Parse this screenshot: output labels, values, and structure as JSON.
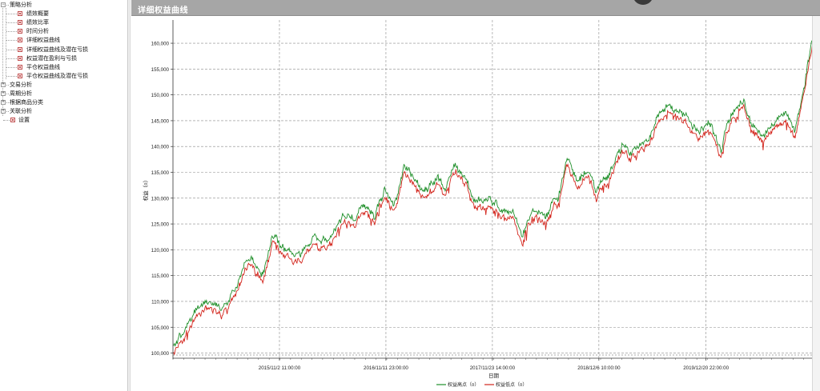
{
  "tree": {
    "items": [
      {
        "label": "策略分析",
        "level": 0,
        "kind": "folder",
        "expanded": true
      },
      {
        "label": "绩效概要",
        "level": 1,
        "kind": "leaf"
      },
      {
        "label": "绩效比率",
        "level": 1,
        "kind": "leaf"
      },
      {
        "label": "时间分析",
        "level": 1,
        "kind": "leaf"
      },
      {
        "label": "详细权益曲线",
        "level": 1,
        "kind": "leaf",
        "selected": true
      },
      {
        "label": "详细权益曲线及潜在亏损",
        "level": 1,
        "kind": "leaf"
      },
      {
        "label": "权益潜在盈利与亏损",
        "level": 1,
        "kind": "leaf"
      },
      {
        "label": "平仓权益曲线",
        "level": 1,
        "kind": "leaf"
      },
      {
        "label": "平仓权益曲线及潜在亏损",
        "level": 1,
        "kind": "leaf"
      },
      {
        "label": "交易分析",
        "level": 0,
        "kind": "folder",
        "expanded": false
      },
      {
        "label": "周期分析",
        "level": 0,
        "kind": "folder",
        "expanded": false
      },
      {
        "label": "根据商品分类",
        "level": 0,
        "kind": "folder",
        "expanded": false
      },
      {
        "label": "关联分析",
        "level": 0,
        "kind": "folder",
        "expanded": false
      },
      {
        "label": "设置",
        "level": 0,
        "kind": "leaf"
      }
    ],
    "expander_plus": "+",
    "expander_minus": "−"
  },
  "panel": {
    "title": "详细权益曲线"
  },
  "colors": {
    "high_series": "#1f8f2a",
    "low_series": "#d3261d",
    "grid": "#8a8a8a",
    "header_bg": "#a6a6a6"
  },
  "chart_data": {
    "type": "line",
    "xlabel": "日期",
    "ylabel": "权益（¤）",
    "ylim": [
      99000,
      164500
    ],
    "yticks": [
      100000,
      105000,
      110000,
      115000,
      120000,
      125000,
      130000,
      135000,
      140000,
      145000,
      150000,
      155000,
      160000
    ],
    "ytick_labels": [
      "100,000",
      "105,000",
      "110,000",
      "115,000",
      "120,000",
      "125,000",
      "130,000",
      "135,000",
      "140,000",
      "145,000",
      "150,000",
      "155,000",
      "160,000"
    ],
    "xticks": [
      "2015/11/2 11:00:00",
      "2016/11/11 23:00:00",
      "2017/11/23 14:00:00",
      "2018/12/6 10:00:00",
      "2019/12/20 22:00:00"
    ],
    "grid": true,
    "legend_position": "bottom-center",
    "series": [
      {
        "name": "权益高点（¤）",
        "color": "#1f8f2a"
      },
      {
        "name": "权益低点（¤）",
        "color": "#d3261d"
      }
    ],
    "x": [
      0,
      0.03,
      0.05,
      0.075,
      0.09,
      0.1,
      0.115,
      0.125,
      0.14,
      0.155,
      0.175,
      0.2,
      0.22,
      0.24,
      0.265,
      0.285,
      0.3,
      0.315,
      0.33,
      0.345,
      0.36,
      0.385,
      0.41,
      0.425,
      0.44,
      0.455,
      0.47,
      0.5,
      0.52,
      0.53,
      0.545,
      0.56,
      0.58,
      0.6,
      0.615,
      0.63,
      0.645,
      0.66,
      0.68,
      0.7,
      0.715,
      0.73,
      0.75,
      0.77,
      0.79,
      0.805,
      0.82,
      0.835,
      0.855,
      0.87,
      0.89,
      0.905,
      0.92,
      0.935,
      0.955,
      0.97,
      0.985,
      1.0
    ],
    "values": [
      100300,
      106000,
      109500,
      107500,
      110500,
      112500,
      117500,
      117500,
      115000,
      122500,
      118500,
      118500,
      121500,
      120500,
      125500,
      125500,
      128000,
      126000,
      131000,
      128000,
      136500,
      130500,
      133000,
      131000,
      135500,
      133000,
      129000,
      128500,
      126500,
      127000,
      122000,
      127000,
      126000,
      130000,
      137000,
      132000,
      135000,
      131000,
      133500,
      139500,
      138500,
      140000,
      143500,
      147500,
      146000,
      144500,
      141500,
      143500,
      138500,
      146000,
      148500,
      143000,
      141500,
      144500,
      145500,
      143000,
      151000,
      163000
    ]
  }
}
